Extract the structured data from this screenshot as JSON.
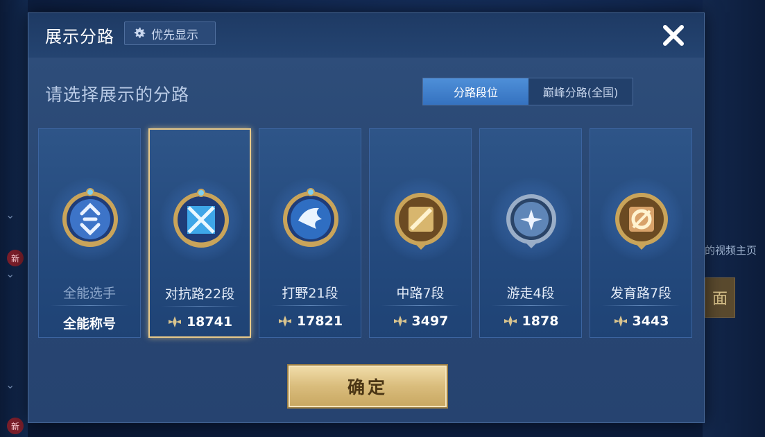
{
  "background": {
    "right_text": "的视频主页",
    "right_button": "面",
    "new_badge": "新"
  },
  "dialog": {
    "title": "展示分路",
    "priority_label": "优先显示",
    "subtitle": "请选择展示的分路",
    "tabs": [
      {
        "label": "分路段位",
        "active": true
      },
      {
        "label": "巅峰分路(全国)",
        "active": false
      }
    ],
    "cards": [
      {
        "name": "全能选手",
        "score": "全能称号",
        "icon": "all-round-badge-icon",
        "selected": false,
        "dim": true
      },
      {
        "name": "对抗路22段",
        "score": "18741",
        "icon": "clash-lane-badge-icon",
        "selected": true,
        "dim": false
      },
      {
        "name": "打野21段",
        "score": "17821",
        "icon": "jungle-badge-icon",
        "selected": false,
        "dim": false
      },
      {
        "name": "中路7段",
        "score": "3497",
        "icon": "mid-lane-badge-icon",
        "selected": false,
        "dim": false
      },
      {
        "name": "游走4段",
        "score": "1878",
        "icon": "roam-badge-icon",
        "selected": false,
        "dim": false
      },
      {
        "name": "发育路7段",
        "score": "3443",
        "icon": "farm-lane-badge-icon",
        "selected": false,
        "dim": false
      }
    ],
    "confirm_label": "确定"
  },
  "colors": {
    "gold": "#e8c98a",
    "panel": "#2a4874",
    "active_tab": "#3f80cc"
  }
}
